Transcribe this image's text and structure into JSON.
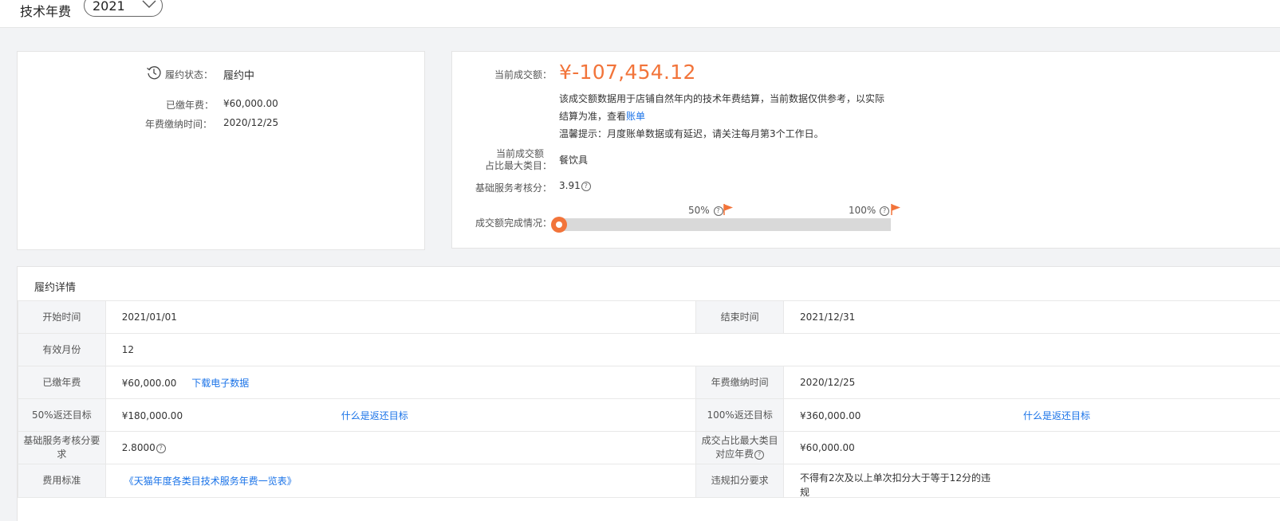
{
  "header": {
    "title": "技术年费",
    "year_selected": "2021"
  },
  "status_card": {
    "status_label": "履约状态：",
    "status_value": "履约中",
    "paid_label": "已缴年费：",
    "paid_value": "¥60,000.00",
    "pay_time_label": "年费缴纳时间：",
    "pay_time_value": "2020/12/25"
  },
  "summary_card": {
    "amount_label": "当前成交额：",
    "amount_value": "¥-107,454.12",
    "note_line1": "该成交额数据用于店铺自然年内的技术年费结算，当前数据仅供参考，以实际",
    "note_line2_prefix": "结算为准，查看",
    "note_link": "账单",
    "tip": "温馨提示：月度账单数据或有延迟，请关注每月第3个工作日。",
    "category_label_line1": "当前成交额",
    "category_label_line2": "占比最大类目：",
    "category_value": "餐饮具",
    "score_label": "基础服务考核分：",
    "score_value": "3.91",
    "progress_label": "成交额完成情况：",
    "progress_fraction": 0,
    "milestone_50": "50%",
    "milestone_100": "100%",
    "accent_color": "#f2743a"
  },
  "detail": {
    "title": "履约详情",
    "rows": {
      "start_label": "开始时间",
      "start_value": "2021/01/01",
      "end_label": "结束时间",
      "end_value": "2021/12/31",
      "months_label": "有效月份",
      "months_value": "12",
      "paid_label": "已缴年费",
      "paid_value": "¥60,000.00",
      "download_link": "下载电子数据",
      "pay_time_label": "年费缴纳时间",
      "pay_time_value": "2020/12/25",
      "target50_label": "50%返还目标",
      "target50_value": "¥180,000.00",
      "target_link_1": "什么是返还目标",
      "target100_label": "100%返还目标",
      "target100_value": "¥360,000.00",
      "target_link_2": "什么是返还目标",
      "score_req_label": "基础服务考核分要求",
      "score_req_value": "2.8000",
      "category_fee_label": "成交占比最大类目对应年费",
      "category_fee_value": "¥60,000.00",
      "fee_std_label": "费用标准",
      "fee_std_link": "《天猫年度各类目技术服务年费一览表》",
      "violation_label": "违规扣分要求",
      "violation_value": "不得有2次及以上单次扣分大于等于12分的违规"
    }
  }
}
